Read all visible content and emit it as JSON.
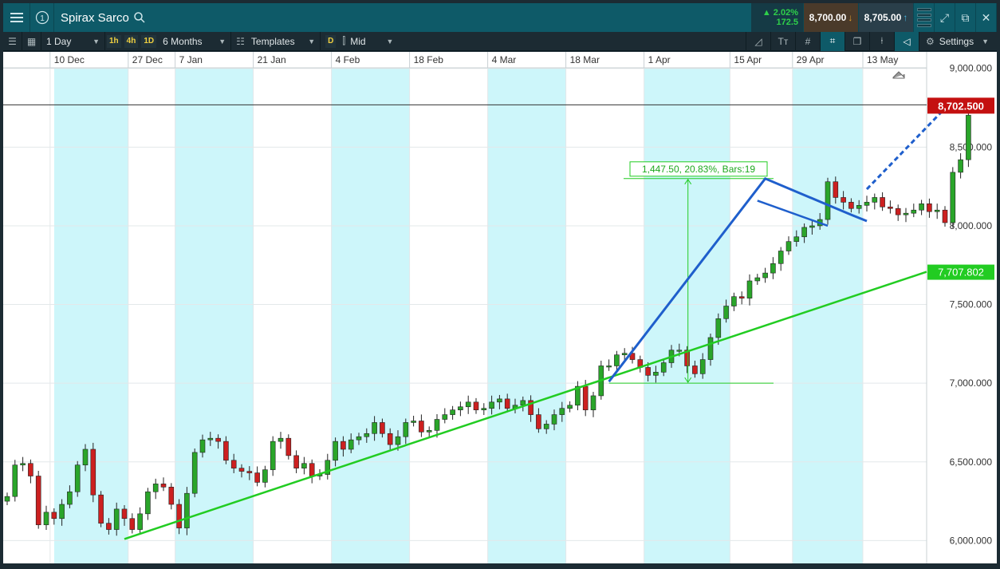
{
  "titlebar": {
    "instrument": "Spirax Sarco",
    "window_number": "1",
    "change_pct": "2.02%",
    "change_abs": "172.5",
    "sell_price": "8,700.00",
    "buy_price": "8,705.00",
    "change_color": "#2fd04a"
  },
  "toolbar": {
    "interval": "1 Day",
    "timeframes": [
      "1h",
      "4h",
      "1D"
    ],
    "range": "6 Months",
    "templates": "Templates",
    "price_type_badge": "D",
    "price_type": "Mid",
    "settings": "Settings"
  },
  "chart_data": {
    "type": "candlestick",
    "title": "",
    "x_ticks": [
      "10 Dec",
      "27 Dec",
      "7 Jan",
      "21 Jan",
      "4 Feb",
      "18 Feb",
      "4 Mar",
      "18 Mar",
      "1 Apr",
      "15 Apr",
      "29 Apr",
      "13 May"
    ],
    "y_ticks": [
      6000,
      6500,
      7000,
      7500,
      8000,
      8500,
      9000
    ],
    "y_tick_labels": [
      "6,000.000",
      "6,500.000",
      "7,000.000",
      "7,500.000",
      "8,000.000",
      "8,500.000",
      "9,000.000"
    ],
    "ylim": [
      5870,
      9090
    ],
    "grid": true,
    "colors": {
      "up": "#2aa52a",
      "down": "#cc2020",
      "trendline": "#22cc22",
      "pattern": "#1f5fcc",
      "measure": "#22cc22",
      "band": "#cdf6fa"
    },
    "current_price": {
      "value": 8702.5,
      "label": "8,702.500",
      "color": "#c41010"
    },
    "trendline_label": {
      "value": 7707.802,
      "label": "7,707.802",
      "color": "#22cc22"
    },
    "measure_label": "1,447.50, 20.83%, Bars:19",
    "close": [
      6280,
      6480,
      6490,
      6410,
      6100,
      6180,
      6140,
      6230,
      6310,
      6480,
      6580,
      6290,
      6110,
      6070,
      6200,
      6140,
      6070,
      6170,
      6310,
      6360,
      6340,
      6230,
      6080,
      6300,
      6560,
      6640,
      6650,
      6630,
      6510,
      6460,
      6440,
      6430,
      6370,
      6450,
      6630,
      6650,
      6540,
      6460,
      6490,
      6410,
      6420,
      6510,
      6630,
      6580,
      6640,
      6660,
      6680,
      6750,
      6680,
      6610,
      6660,
      6750,
      6760,
      6690,
      6700,
      6770,
      6800,
      6830,
      6850,
      6880,
      6830,
      6840,
      6880,
      6900,
      6840,
      6860,
      6890,
      6800,
      6710,
      6740,
      6800,
      6840,
      6860,
      6980,
      6830,
      6920,
      7110,
      7110,
      7180,
      7190,
      7150,
      7100,
      7050,
      7070,
      7130,
      7210,
      7210,
      7110,
      7060,
      7150,
      7290,
      7410,
      7490,
      7550,
      7540,
      7650,
      7670,
      7700,
      7760,
      7840,
      7900,
      7930,
      7990,
      8000,
      8040,
      8280,
      8180,
      8150,
      8110,
      8130,
      8150,
      8180,
      8120,
      8110,
      8070,
      8080,
      8100,
      8140,
      8090,
      8100,
      8020,
      8340,
      8420,
      8702.5
    ],
    "trendline": {
      "start": [
        15,
        6010
      ],
      "end": [
        121,
        7660
      ],
      "extend_to_right_axis": 7707.802
    },
    "pattern_lines": [
      [
        [
          77,
          7010
        ],
        [
          97,
          8300
        ],
        [
          108,
          8070
        ],
        [
          110,
          8030
        ],
        [
          119,
          8800
        ]
      ]
    ],
    "pennant": [
      [
        96,
        8160
      ],
      [
        105,
        8000
      ]
    ],
    "measure": {
      "bar_from": 77,
      "bar_to": 96,
      "low": 7000,
      "high": 8300
    }
  }
}
